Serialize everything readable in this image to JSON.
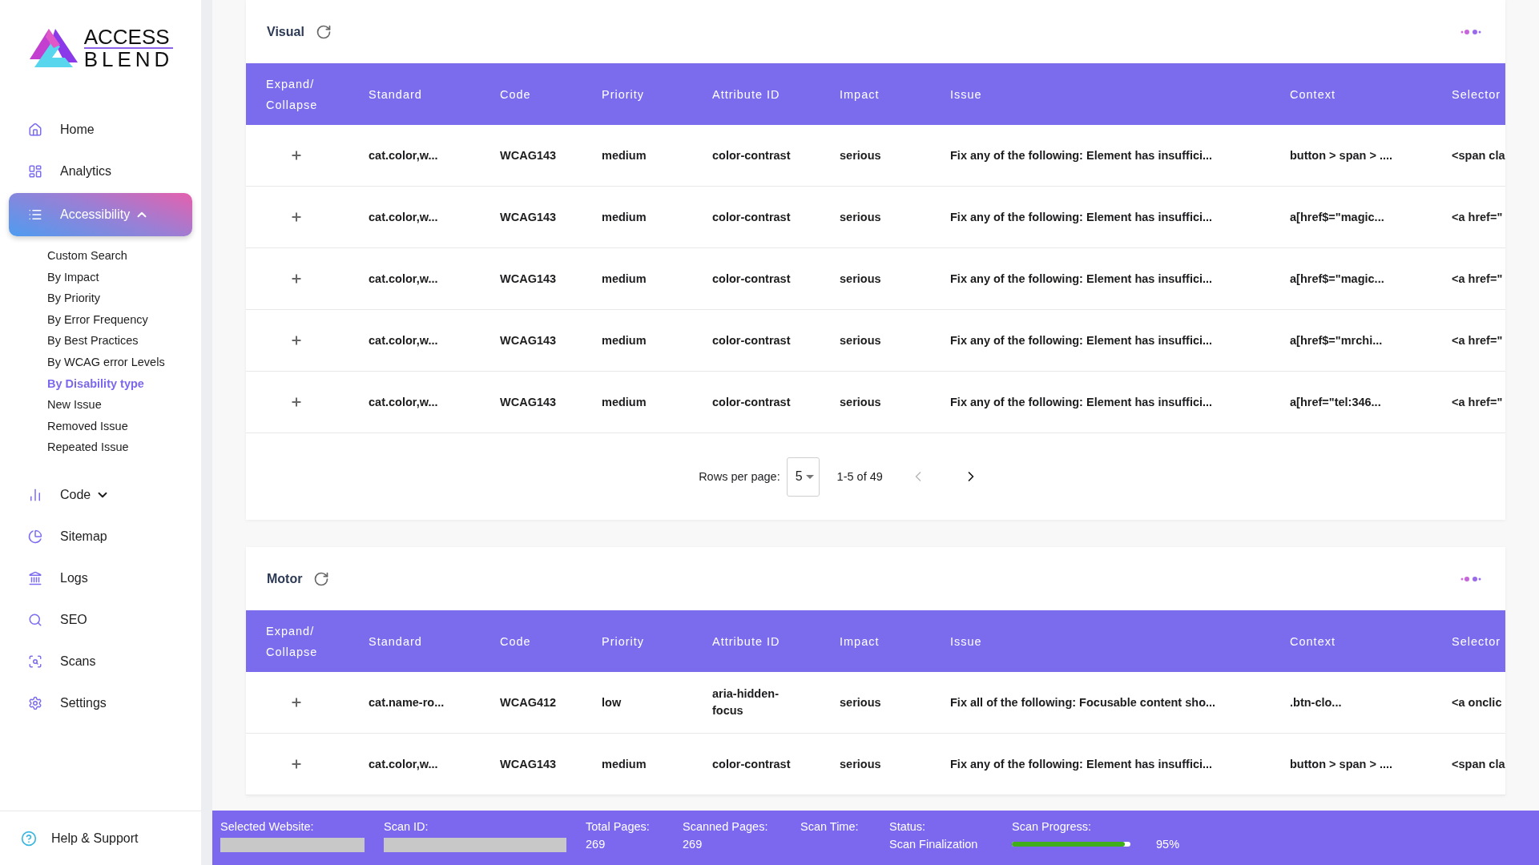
{
  "brand": {
    "line1": "ACCESS",
    "line2": "BLEND"
  },
  "sidebar": {
    "items": [
      {
        "label": "Home",
        "selected": false
      },
      {
        "label": "Analytics",
        "selected": false
      },
      {
        "label": "Accessibility",
        "selected": true,
        "expanded": true,
        "children": [
          {
            "label": "Custom Search",
            "selected": false
          },
          {
            "label": "By Impact",
            "selected": false
          },
          {
            "label": "By Priority",
            "selected": false
          },
          {
            "label": "By Error Frequency",
            "selected": false
          },
          {
            "label": "By Best Practices",
            "selected": false
          },
          {
            "label": "By WCAG error Levels",
            "selected": false
          },
          {
            "label": "By Disability type",
            "selected": true
          },
          {
            "label": "New Issue",
            "selected": false
          },
          {
            "label": "Removed Issue",
            "selected": false
          },
          {
            "label": "Repeated Issue",
            "selected": false
          }
        ]
      },
      {
        "label": "Code",
        "selected": false,
        "expanded": false
      },
      {
        "label": "Sitemap",
        "selected": false
      },
      {
        "label": "Logs",
        "selected": false
      },
      {
        "label": "SEO",
        "selected": false
      },
      {
        "label": "Scans",
        "selected": false
      },
      {
        "label": "Settings",
        "selected": false
      }
    ],
    "help": "Help & Support"
  },
  "sections": [
    {
      "title": "Visual",
      "expand_header": "Expand/ Collapse",
      "columns": [
        "Standard",
        "Code",
        "Priority",
        "Attribute ID",
        "Impact",
        "Issue",
        "Context",
        "Selector"
      ],
      "rows": [
        {
          "expanded": false,
          "cells": [
            "cat.color,w...",
            "WCAG143",
            "medium",
            "color-contrast",
            "serious",
            "Fix any of the following: Element has insuffici...",
            "button > span > ....",
            "<span cla"
          ]
        },
        {
          "expanded": false,
          "cells": [
            "cat.color,w...",
            "WCAG143",
            "medium",
            "color-contrast",
            "serious",
            "Fix any of the following: Element has insuffici...",
            "a[href$=\"magic...",
            "<a href=\""
          ]
        },
        {
          "expanded": false,
          "cells": [
            "cat.color,w...",
            "WCAG143",
            "medium",
            "color-contrast",
            "serious",
            "Fix any of the following: Element has insuffici...",
            "a[href$=\"magic...",
            "<a href=\""
          ]
        },
        {
          "expanded": false,
          "cells": [
            "cat.color,w...",
            "WCAG143",
            "medium",
            "color-contrast",
            "serious",
            "Fix any of the following: Element has insuffici...",
            "a[href$=\"mrchi...",
            "<a href=\""
          ]
        },
        {
          "expanded": false,
          "cells": [
            "cat.color,w...",
            "WCAG143",
            "medium",
            "color-contrast",
            "serious",
            "Fix any of the following: Element has insuffici...",
            "a[href=\"tel:346...",
            "<a href=\""
          ]
        }
      ],
      "pagination": {
        "label": "Rows per page:",
        "value": "5",
        "range": "1-5 of 49",
        "prev_disabled": true,
        "next_disabled": false
      }
    },
    {
      "title": "Motor",
      "expand_header": "Expand/ Collapse",
      "columns": [
        "Standard",
        "Code",
        "Priority",
        "Attribute ID",
        "Impact",
        "Issue",
        "Context",
        "Selector"
      ],
      "rows": [
        {
          "expanded": false,
          "cells": [
            "cat.name-ro...",
            "WCAG412",
            "low",
            "aria-hidden-focus",
            "serious",
            "Fix all of the following: Focusable content sho...",
            ".btn-clo...",
            "<a onclic"
          ]
        },
        {
          "expanded": false,
          "cells": [
            "cat.color,w...",
            "WCAG143",
            "medium",
            "color-contrast",
            "serious",
            "Fix any of the following: Element has insuffici...",
            "button > span > ....",
            "<span cla"
          ]
        }
      ]
    }
  ],
  "status_bar": {
    "fields": [
      {
        "kind": "redacted",
        "label": "Selected Website:"
      },
      {
        "kind": "redacted",
        "label": "Scan ID:"
      },
      {
        "kind": "text",
        "label": "Total Pages:",
        "value": "269"
      },
      {
        "kind": "text",
        "label": "Scanned Pages:",
        "value": "269"
      },
      {
        "kind": "text",
        "label": "Scan Time:"
      },
      {
        "kind": "text",
        "label": "Status:",
        "value": "Scan Finalization"
      },
      {
        "kind": "progress",
        "label": "Scan Progress:",
        "level": 0.95,
        "reading": "95%"
      }
    ]
  }
}
